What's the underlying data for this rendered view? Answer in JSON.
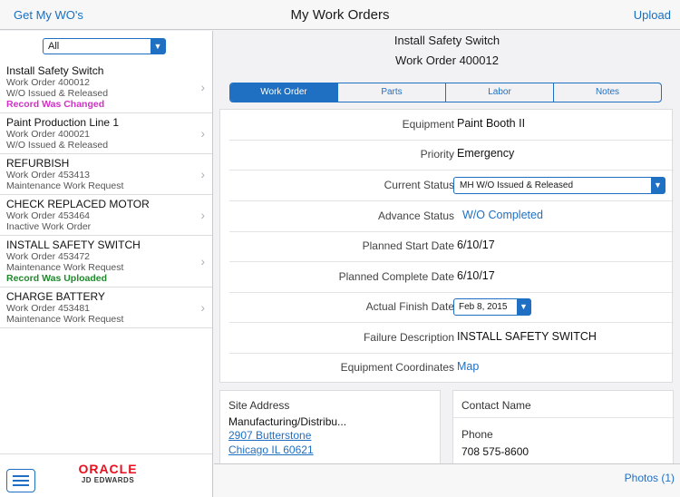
{
  "header": {
    "left_button": "Get My WO's",
    "title": "My Work Orders",
    "right_button": "Upload"
  },
  "sidebar": {
    "filter": "All",
    "items": [
      {
        "title": "Install Safety Switch",
        "number": "Work Order 400012",
        "status": "W/O Issued & Released",
        "flag": "Record Was Changed",
        "flag_color": "#d42fc8"
      },
      {
        "title": "Paint Production Line 1",
        "number": "Work Order 400021",
        "status": "W/O Issued & Released",
        "flag": "",
        "flag_color": ""
      },
      {
        "title": "REFURBISH",
        "number": "Work Order 453413",
        "status": "Maintenance Work Request",
        "flag": "",
        "flag_color": ""
      },
      {
        "title": "CHECK REPLACED MOTOR",
        "number": "Work Order 453464",
        "status": "Inactive Work Order",
        "flag": "",
        "flag_color": ""
      },
      {
        "title": "INSTALL SAFETY SWITCH",
        "number": "Work Order 453472",
        "status": "Maintenance Work Request",
        "flag": "Record Was Uploaded",
        "flag_color": "#1f8a2b"
      },
      {
        "title": "CHARGE BATTERY",
        "number": "Work Order 453481",
        "status": "Maintenance Work Request",
        "flag": "",
        "flag_color": ""
      }
    ],
    "logo_top": "ORACLE",
    "logo_bottom": "JD EDWARDS"
  },
  "main": {
    "title": "Install Safety Switch",
    "subtitle": "Work Order 400012",
    "tabs": [
      {
        "label": "Work Order",
        "active": true
      },
      {
        "label": "Parts",
        "active": false
      },
      {
        "label": "Labor",
        "active": false
      },
      {
        "label": "Notes",
        "active": false
      }
    ],
    "fields": {
      "equipment": {
        "label": "Equipment",
        "value": "Paint Booth II"
      },
      "priority": {
        "label": "Priority",
        "value": "Emergency"
      },
      "current_status": {
        "label": "Current Status",
        "value": "MH W/O Issued & Released"
      },
      "advance_status": {
        "label": "Advance Status",
        "value": "W/O Completed"
      },
      "planned_start": {
        "label": "Planned Start Date",
        "value": "6/10/17"
      },
      "planned_complete": {
        "label": "Planned Complete Date",
        "value": "6/10/17"
      },
      "actual_finish": {
        "label": "Actual Finish Date",
        "value": "Feb 8, 2015"
      },
      "failure_description": {
        "label": "Failure Description",
        "value": "INSTALL SAFETY SWITCH"
      },
      "equipment_coordinates": {
        "label": "Equipment Coordinates",
        "value": "Map"
      }
    },
    "site": {
      "label": "Site Address",
      "name": "Manufacturing/Distribu...",
      "street": "2907 Butterstone",
      "city": "Chicago IL 60621"
    },
    "contact": {
      "label": "Contact Name",
      "phone_label": "Phone",
      "phone": "708 575-8600"
    },
    "photos": "Photos (1)"
  },
  "colors": {
    "accent": "#1f6fc2",
    "changed": "#d42fc8",
    "uploaded": "#1f8a2b"
  }
}
